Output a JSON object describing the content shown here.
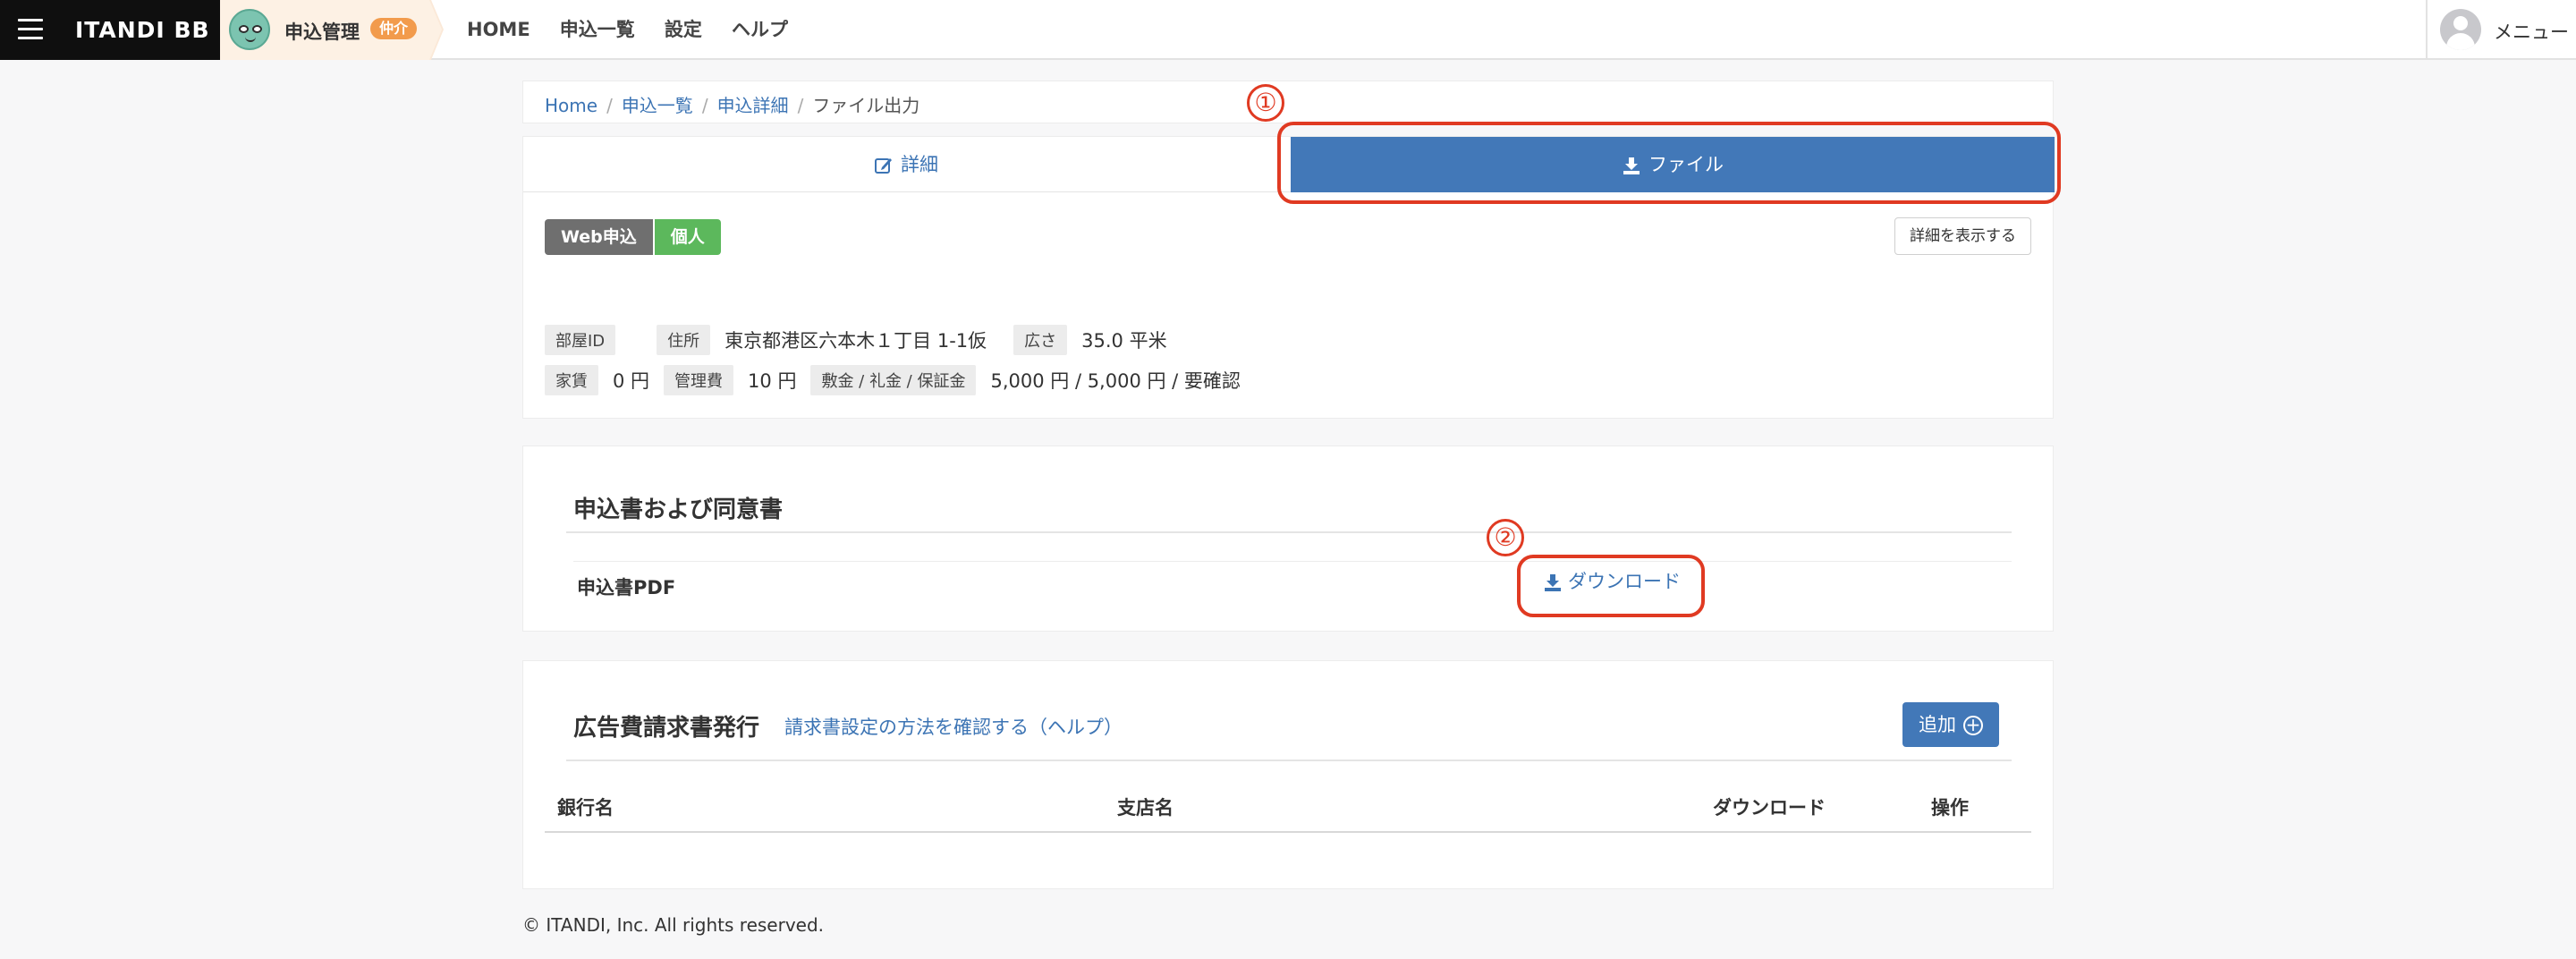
{
  "header": {
    "brand": "ITANDI BB",
    "app_name": "申込管理",
    "app_badge": "仲介",
    "nav": [
      "HOME",
      "申込一覧",
      "設定",
      "ヘルプ"
    ],
    "user_menu": "メニュー"
  },
  "breadcrumb": {
    "items": [
      "Home",
      "申込一覧",
      "申込詳細"
    ],
    "current": "ファイル出力"
  },
  "tabs": {
    "detail": "詳細",
    "file": "ファイル"
  },
  "application": {
    "badges": [
      "Web申込",
      "個人"
    ],
    "show_detail_button": "詳細を表示する",
    "row1": [
      {
        "label": "部屋ID",
        "value": ""
      },
      {
        "label": "住所",
        "value": "東京都港区六本木１丁目 1-1仮"
      },
      {
        "label": "広さ",
        "value": "35.0 平米"
      }
    ],
    "row2": [
      {
        "label": "家賃",
        "value": "0 円"
      },
      {
        "label": "管理費",
        "value": "10 円"
      },
      {
        "label": "敷金 / 礼金 / 保証金",
        "value": "5,000 円 / 5,000 円 / 要確認"
      }
    ]
  },
  "consent": {
    "title": "申込書および同意書",
    "pdf_label": "申込書PDF",
    "download": "ダウンロード"
  },
  "ad_invoice": {
    "title": "広告費請求書発行",
    "help_link": "請求書設定の方法を確認する（ヘルプ）",
    "add_button": "追加",
    "columns": [
      "銀行名",
      "支店名",
      "ダウンロード",
      "操作"
    ]
  },
  "annotations": [
    "①",
    "②"
  ],
  "annotation_color": "#e03a22",
  "accent_color": "#4278b8",
  "footer": "© ITANDI, Inc. All rights reserved."
}
